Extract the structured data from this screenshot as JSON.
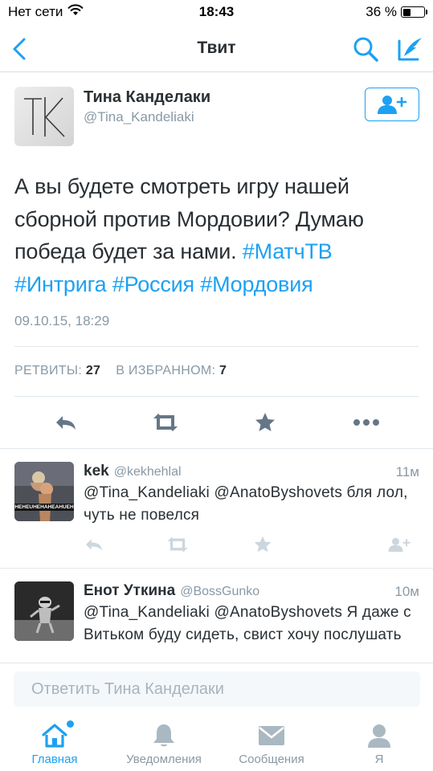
{
  "status_bar": {
    "carrier": "Нет сети",
    "time": "18:43",
    "battery": "36 %",
    "battery_level": 0.36
  },
  "nav": {
    "title": "Твит",
    "back_icon": "chevron-left-icon",
    "search_icon": "search-icon",
    "compose_icon": "compose-icon"
  },
  "tweet": {
    "author": {
      "name": "Тина Канделаки",
      "handle": "@Tina_Kandeliaki",
      "avatar_text": "TK"
    },
    "text_plain_1": "А вы будете смотреть игру нашей сборной против Мордовии? Думаю победа будет за нами. ",
    "hashtags": [
      "#МатчТВ",
      "#Интрига",
      "#Россия",
      "#Мордовия"
    ],
    "date": "09.10.15, 18:29",
    "stats": {
      "retweets_label": "РЕТВИТЫ:",
      "retweets_count": "27",
      "favorites_label": "В ИЗБРАННОМ:",
      "favorites_count": "7"
    }
  },
  "replies": [
    {
      "name": "kek",
      "handle": "@kekhehlal",
      "time": "11м",
      "text": "@Tina_Kandeliaki @AnatoByshovets бля лол, чуть не повелся",
      "avatar_caption": "HEHEUHEHAHEAHUEH"
    },
    {
      "name": "Енот Уткина",
      "handle": "@BossGunko",
      "time": "10м",
      "text": "@Tina_Kandeliaki @AnatoByshovets Я даже с Витьком буду сидеть, свист хочу послушать"
    }
  ],
  "composer": {
    "placeholder": "Ответить Тина Канделаки"
  },
  "tabs": [
    {
      "label": "Главная",
      "icon": "home-icon",
      "active": true
    },
    {
      "label": "Уведомления",
      "icon": "bell-icon",
      "active": false
    },
    {
      "label": "Сообщения",
      "icon": "envelope-icon",
      "active": false
    },
    {
      "label": "Я",
      "icon": "person-icon",
      "active": false
    }
  ],
  "colors": {
    "accent": "#1da1f2",
    "text": "#292f33",
    "muted": "#8899a6",
    "icon_gray": "#aab8c2",
    "divider": "#e1e8ed"
  }
}
